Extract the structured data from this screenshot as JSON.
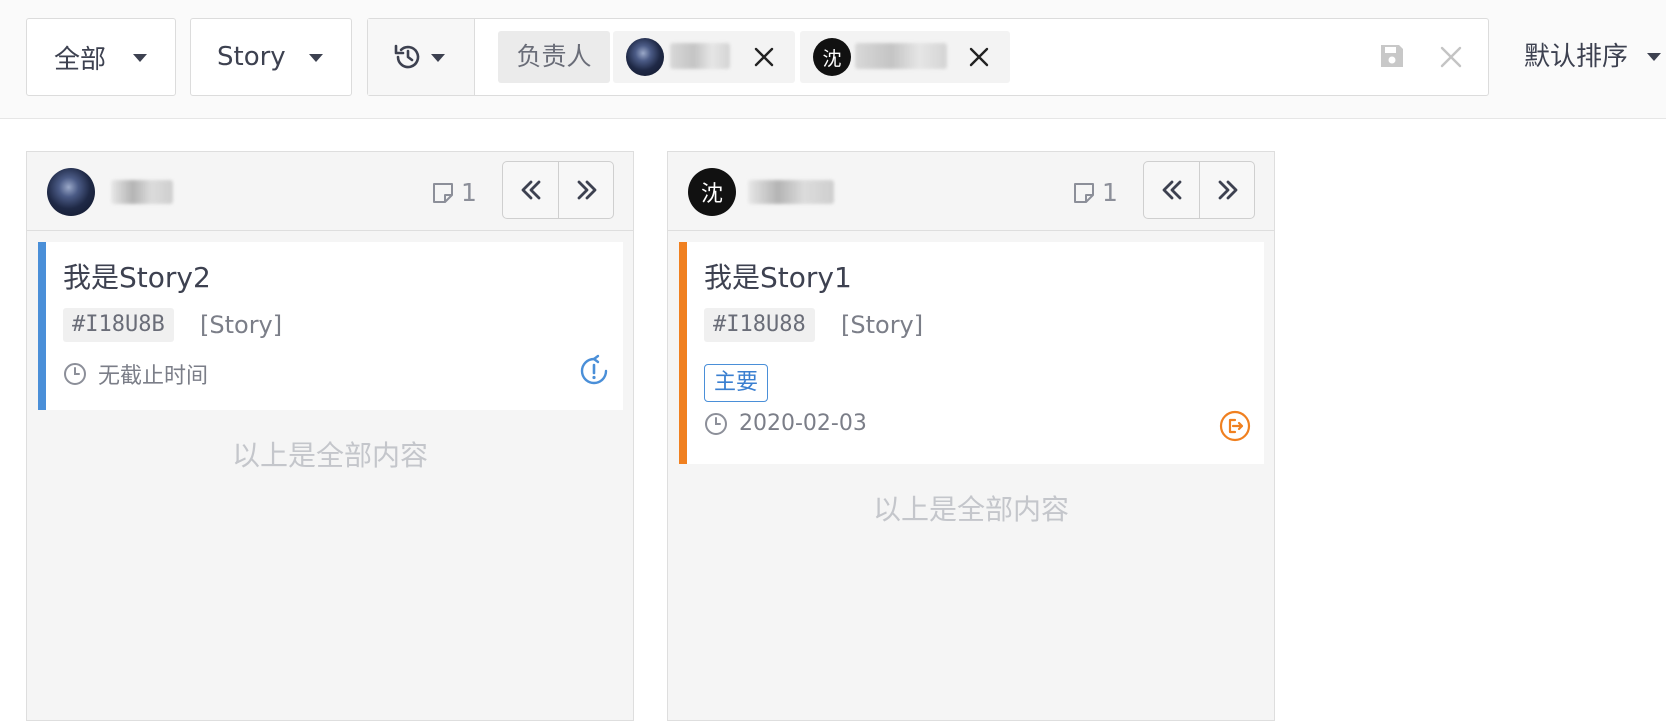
{
  "toolbar": {
    "scope_filter": "全部",
    "type_filter": "Story",
    "filter_label": "负责人",
    "sort_label": "默认排序"
  },
  "columns": [
    {
      "assignee_initial": "",
      "count": "1",
      "card": {
        "title": "我是Story2",
        "code": "#I18U8B",
        "kind": "[Story]",
        "due": "无截止时间",
        "accent": "#4a8fd8"
      },
      "end_note": "以上是全部内容"
    },
    {
      "assignee_initial": "沈",
      "count": "1",
      "card": {
        "title": "我是Story1",
        "code": "#I18U88",
        "kind": "[Story]",
        "priority": "主要",
        "due": "2020-02-03",
        "accent": "#f08020"
      },
      "end_note": "以上是全部内容"
    }
  ],
  "chips": [
    {
      "initial": ""
    },
    {
      "initial": "沈"
    }
  ],
  "colors": {
    "blue_accent": "#4a8fd8",
    "orange_accent": "#f08020",
    "text_primary": "#3d4150",
    "muted": "#c4c6cb"
  },
  "icons": [
    "caret-down-icon",
    "history-icon",
    "close-icon",
    "save-icon",
    "note-icon",
    "double-left-icon",
    "double-right-icon",
    "clock-icon",
    "status-sync-icon",
    "status-exit-icon"
  ]
}
